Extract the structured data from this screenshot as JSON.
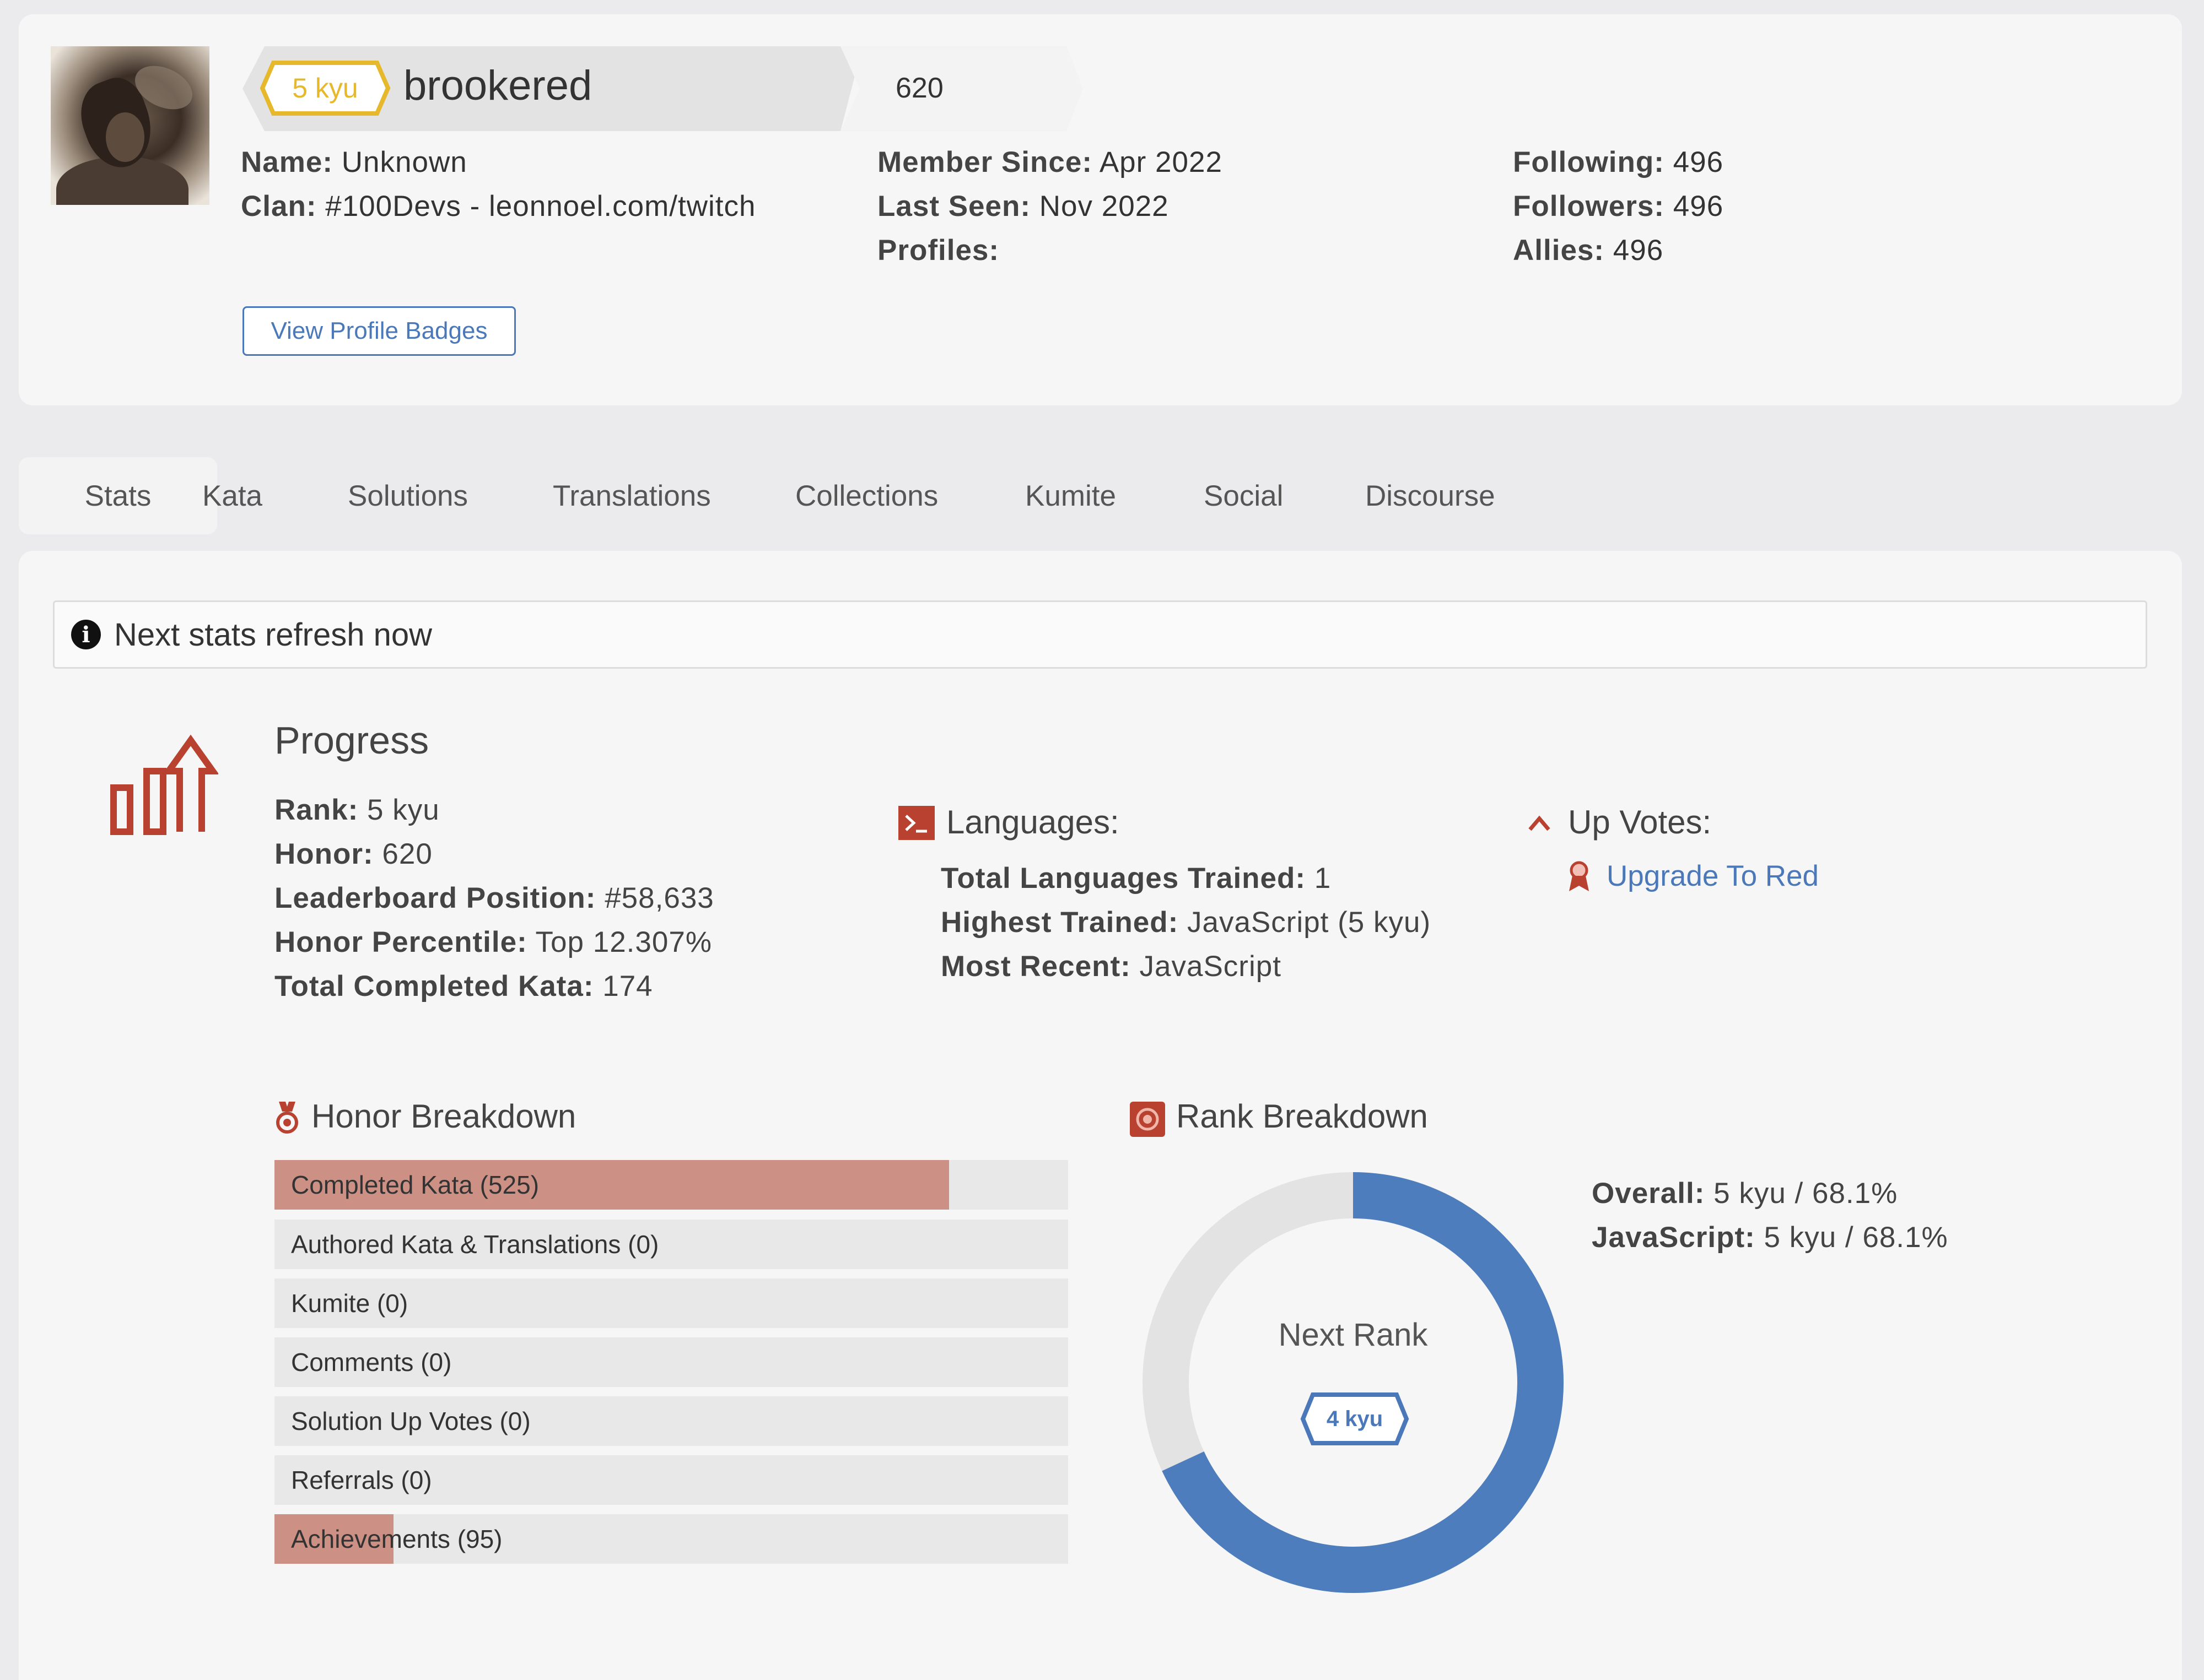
{
  "profile": {
    "rank_badge": "5 kyu",
    "username": "brookered",
    "honor": "620",
    "name_label": "Name:",
    "name_value": "Unknown",
    "clan_label": "Clan:",
    "clan_value": "#100Devs - leonnoel.com/twitch",
    "member_since_label": "Member Since:",
    "member_since_value": "Apr 2022",
    "last_seen_label": "Last Seen:",
    "last_seen_value": "Nov 2022",
    "profiles_label": "Profiles:",
    "following_label": "Following:",
    "following_value": "496",
    "followers_label": "Followers:",
    "followers_value": "496",
    "allies_label": "Allies:",
    "allies_value": "496",
    "badges_button": "View Profile Badges"
  },
  "tabs": [
    "Stats",
    "Kata",
    "Solutions",
    "Translations",
    "Collections",
    "Kumite",
    "Social",
    "Discourse"
  ],
  "infobar": {
    "text": "Next stats refresh now"
  },
  "progress": {
    "title": "Progress",
    "rank_label": "Rank:",
    "rank_value": "5 kyu",
    "honor_label": "Honor:",
    "honor_value": "620",
    "leaderboard_label": "Leaderboard Position:",
    "leaderboard_value": "#58,633",
    "percentile_label": "Honor Percentile:",
    "percentile_value": "Top 12.307%",
    "completed_label": "Total Completed Kata:",
    "completed_value": "174"
  },
  "languages": {
    "title": "Languages:",
    "trained_label": "Total Languages Trained:",
    "trained_value": "1",
    "highest_label": "Highest Trained:",
    "highest_value": "JavaScript (5 kyu)",
    "recent_label": "Most Recent:",
    "recent_value": "JavaScript"
  },
  "upvotes": {
    "title": "Up Votes:",
    "upgrade_link": "Upgrade To Red"
  },
  "honor_breakdown": {
    "title": "Honor Breakdown",
    "rows": [
      {
        "label": "Completed Kata (525)",
        "fill": 0.85
      },
      {
        "label": "Authored Kata & Translations (0)",
        "fill": 0
      },
      {
        "label": "Kumite (0)",
        "fill": 0
      },
      {
        "label": "Comments (0)",
        "fill": 0
      },
      {
        "label": "Solution Up Votes (0)",
        "fill": 0
      },
      {
        "label": "Referrals (0)",
        "fill": 0
      },
      {
        "label": "Achievements (95)",
        "fill": 0.15
      }
    ]
  },
  "rank_breakdown": {
    "title": "Rank Breakdown",
    "next_rank_label": "Next Rank",
    "next_rank": "4 kyu",
    "progress_fraction": 0.681,
    "overall_label": "Overall:",
    "overall_value": "5 kyu / 68.1%",
    "js_label": "JavaScript:",
    "js_value": "5 kyu / 68.1%"
  },
  "colors": {
    "accent_red": "#b8412f",
    "link_blue": "#4a78b8",
    "donut_blue": "#4d7dbd",
    "kyu_yellow": "#e6b82c"
  }
}
